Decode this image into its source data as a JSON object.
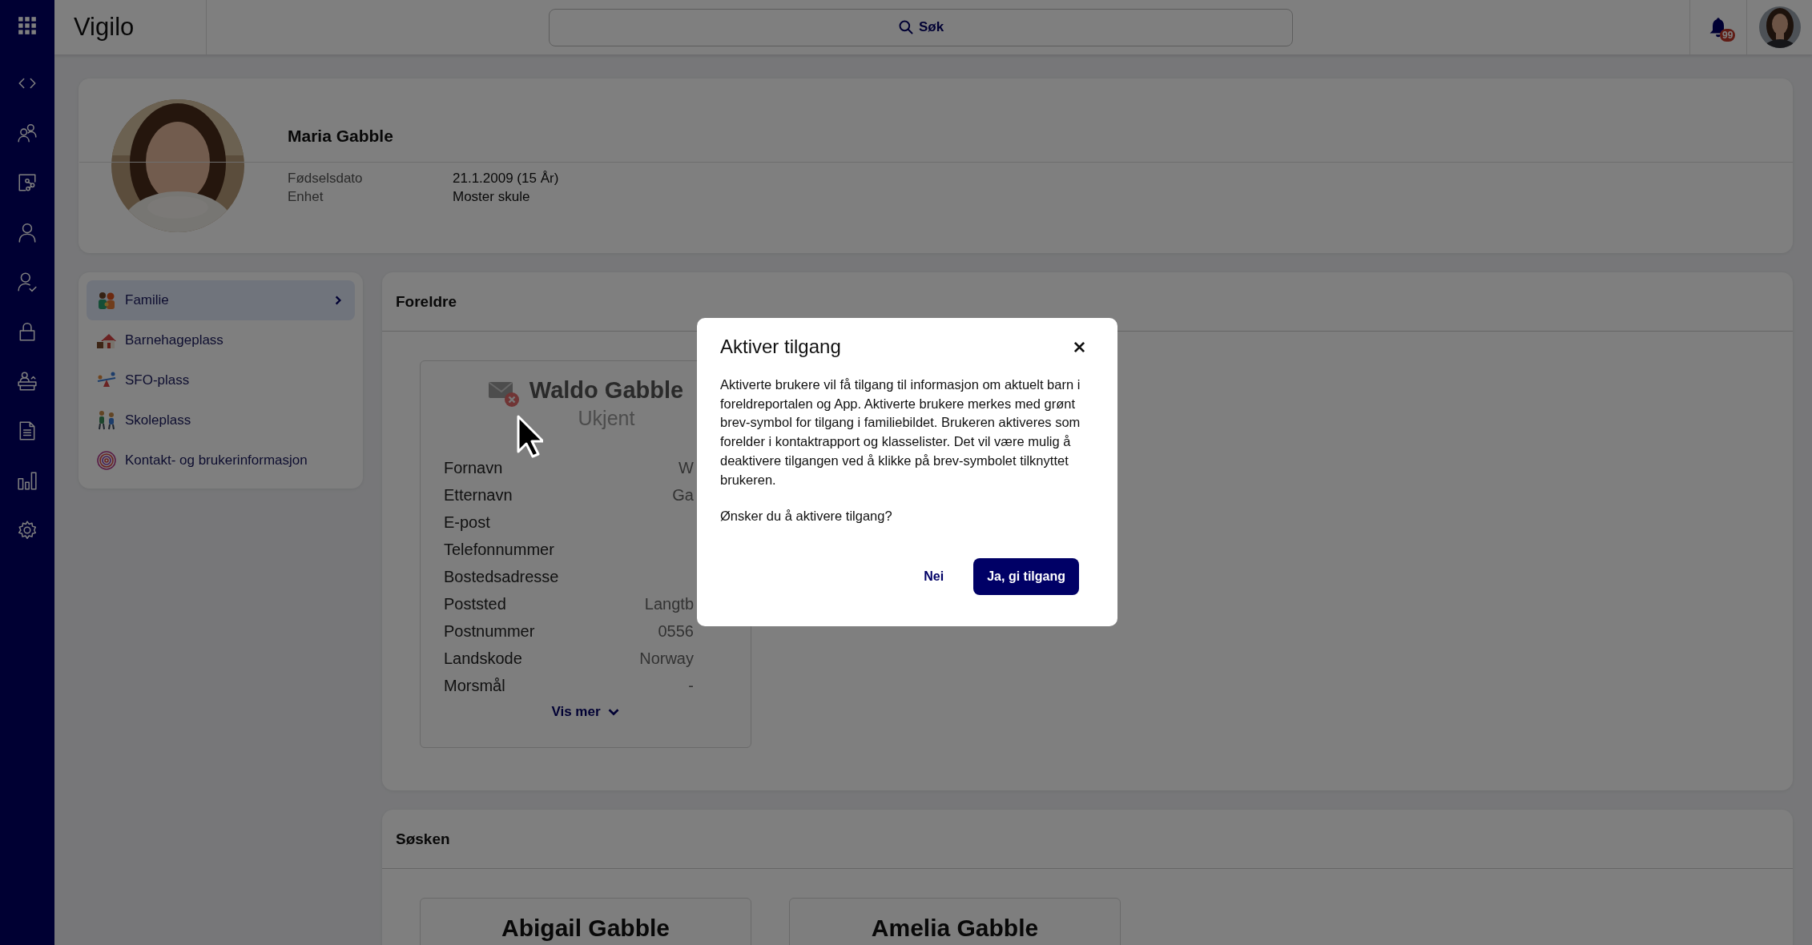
{
  "header": {
    "logo": "Vigilo",
    "search": {
      "placeholder": "Søk"
    },
    "notifications": {
      "badge": "99"
    }
  },
  "profile": {
    "name": "Maria Gabble",
    "details": [
      {
        "label": "Fødselsdato",
        "value": "21.1.2009 (15 År)"
      },
      {
        "label": "Enhet",
        "value": "Moster skule"
      }
    ]
  },
  "menu": {
    "items": [
      {
        "label": "Familie",
        "selected": true
      },
      {
        "label": "Barnehageplass",
        "selected": false
      },
      {
        "label": "SFO-plass",
        "selected": false
      },
      {
        "label": "Skoleplass",
        "selected": false
      },
      {
        "label": "Kontakt- og brukerinformasjon",
        "selected": false
      }
    ]
  },
  "parents": {
    "title": "Foreldre",
    "cards": [
      {
        "name": "Waldo Gabble",
        "role": "Ukjent",
        "access": false,
        "show_more": "Vis mer",
        "fields": [
          {
            "label": "Fornavn",
            "value": "W"
          },
          {
            "label": "Etternavn",
            "value": "Ga"
          },
          {
            "label": "E-post"
          },
          {
            "label": "Telefonnummer"
          },
          {
            "label": "Bostedsadresse"
          },
          {
            "label": "Poststed",
            "value": "Langtb"
          },
          {
            "label": "Postnummer",
            "value": "0556"
          },
          {
            "label": "Landskode",
            "value": "Norway"
          },
          {
            "label": "Morsmål",
            "value": "-"
          }
        ]
      }
    ]
  },
  "siblings": {
    "title": "Søsken",
    "cards": [
      {
        "name": "Abigail Gabble"
      },
      {
        "name": "Amelia Gabble"
      }
    ]
  },
  "dialog": {
    "title": "Aktiver tilgang",
    "paragraphs": [
      "Aktiverte brukere vil få tilgang til informasjon om aktuelt barn i foreldreportalen og App. Aktiverte brukere merkes med grønt brev-symbol for tilgang i familiebildet. Brukeren aktiveres som forelder i kontaktrapport og klasselister. Det vil være mulig å deaktivere tilgangen ved å klikke på brev-symbolet tilknyttet brukeren.",
      "Ønsker du å aktivere tilgang?"
    ],
    "buttons": [
      {
        "label": "Nei",
        "kind": "secondary"
      },
      {
        "label": "Ja, gi tilgang",
        "kind": "primary"
      }
    ]
  }
}
